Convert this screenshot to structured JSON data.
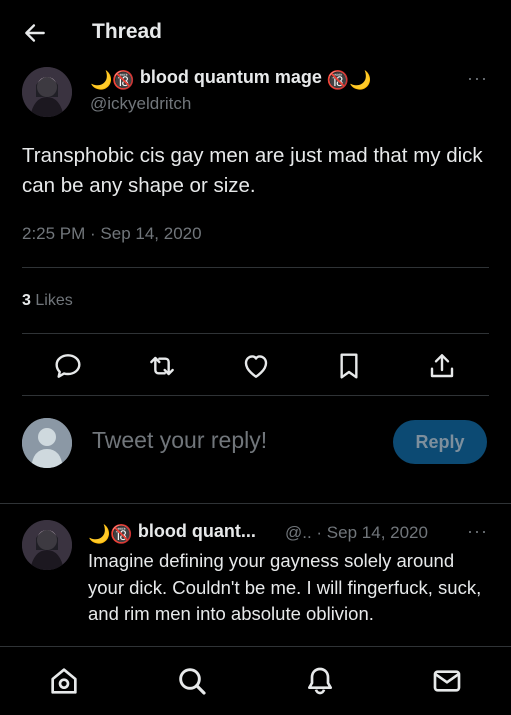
{
  "header": {
    "title": "Thread"
  },
  "tweet": {
    "name_left_emojis": "🌙🔞",
    "name_text": "blood quantum mage",
    "name_right_emojis": "🔞🌙",
    "handle": "@ickyeldritch",
    "more": "···",
    "text": "Transphobic cis gay men are just mad that my dick can be any shape or size.",
    "timestamp": "2:25 PM · Sep 14, 2020",
    "likes_count": "3",
    "likes_label": "Likes"
  },
  "reply_box": {
    "placeholder": "Tweet your reply!",
    "button_label": "Reply"
  },
  "reply": {
    "name_emojis": "🌙🔞",
    "name_text": "blood quant...",
    "handle_date": "@.. · Sep 14, 2020",
    "more": "···",
    "text": "Imagine defining your gayness solely around your dick. Couldn't be me. I will fingerfuck, suck, and rim men into absolute oblivion."
  },
  "nav": [
    "home-icon",
    "search-icon",
    "notifications-icon",
    "messages-icon"
  ]
}
